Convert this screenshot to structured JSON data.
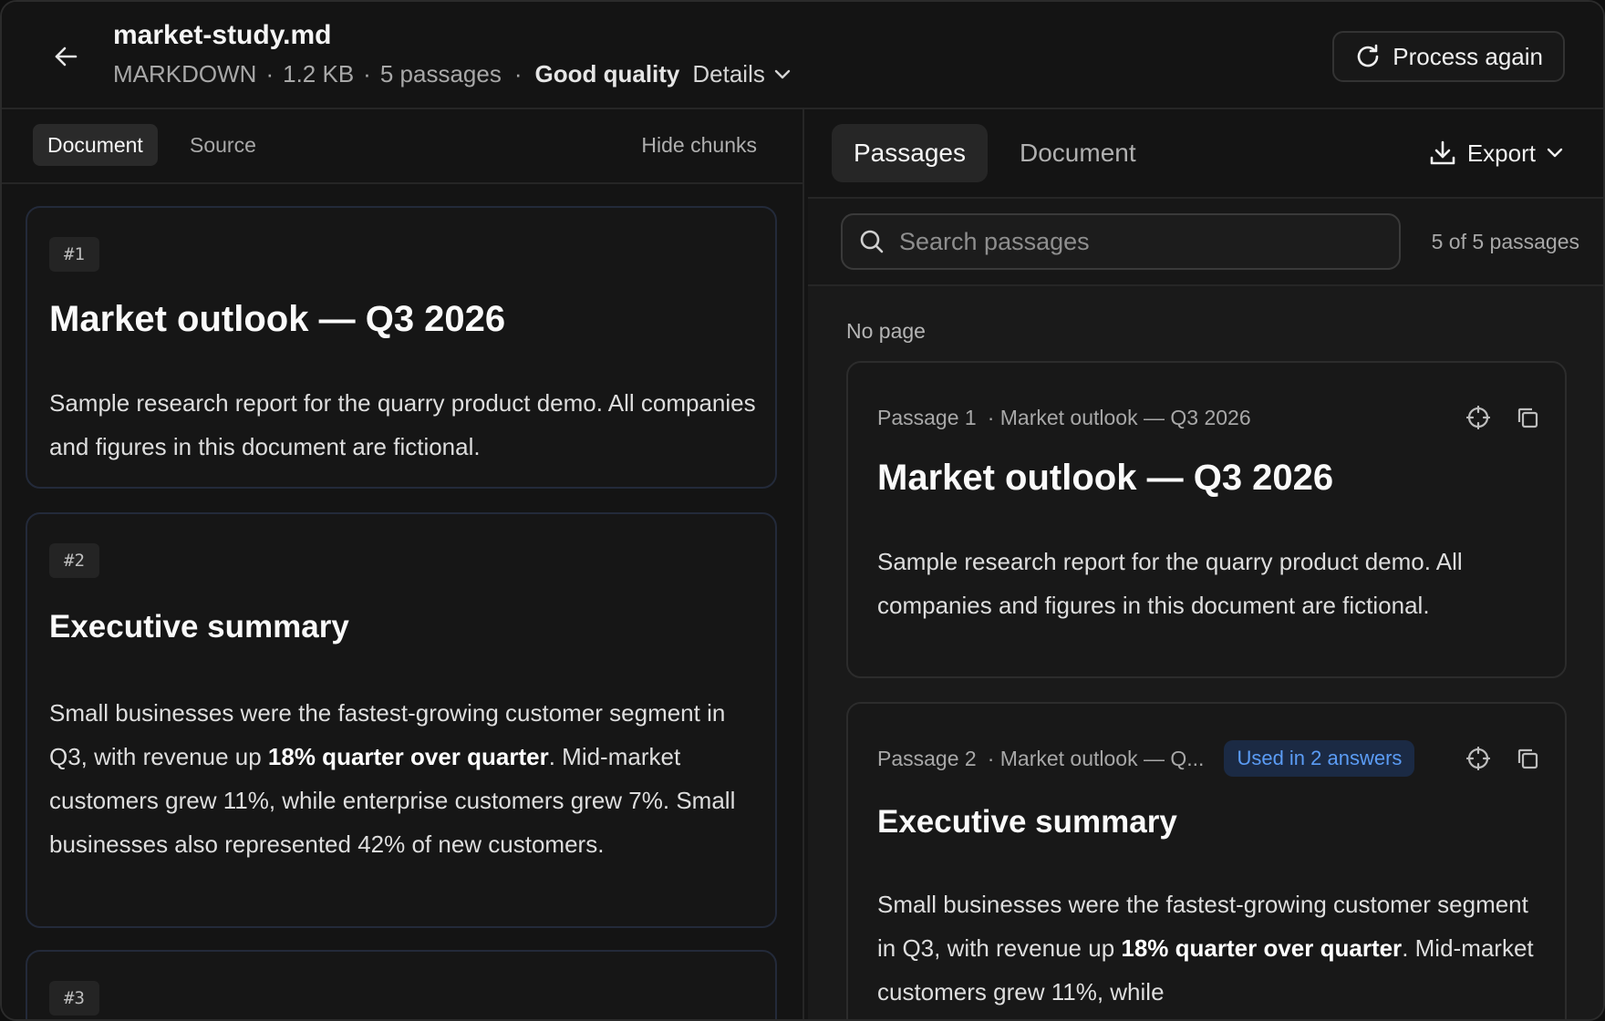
{
  "header": {
    "file_name": "market-study.md",
    "format": "MARKDOWN",
    "size": "1.2 KB",
    "passages_count": "5 passages",
    "quality": "Good quality",
    "details_label": "Details",
    "process_again_label": "Process again"
  },
  "left": {
    "tabs": {
      "document": "Document",
      "source": "Source"
    },
    "hide_chunks_label": "Hide chunks",
    "chunks": [
      {
        "badge": "#1",
        "heading": "Market outlook — Q3 2026",
        "text": "Sample research report for the quarry product demo. All companies and figures in this document are fictional."
      },
      {
        "badge": "#2",
        "heading": "Executive summary",
        "text_before": "Small businesses were the fastest-growing customer segment in Q3, with revenue up ",
        "text_bold": "18% quarter over quarter",
        "text_after": ". Mid-market customers grew 11%, while enterprise customers grew 7%. Small businesses also represented 42% of new customers."
      },
      {
        "badge": "#3"
      }
    ]
  },
  "right": {
    "tabs": {
      "passages": "Passages",
      "document": "Document"
    },
    "export_label": "Export",
    "search_placeholder": "Search passages",
    "count_label": "5 of 5 passages",
    "group_label": "No page",
    "passages": [
      {
        "label": "Passage 1",
        "heading_ref": "· Market outlook — Q3 2026",
        "heading": "Market outlook — Q3 2026",
        "text": "Sample research report for the quarry product demo. All companies and figures in this document are fictional."
      },
      {
        "label": "Passage 2",
        "heading_ref": "· Market outlook — Q...",
        "used_badge": "Used in 2 answers",
        "heading": "Executive summary",
        "text_before": "Small businesses were the fastest-growing customer segment in Q3, with revenue up ",
        "text_bold": "18% quarter over quarter",
        "text_after": ". Mid-market customers grew 11%, while"
      }
    ]
  },
  "icons": {
    "back": "arrow-left-icon",
    "refresh": "refresh-icon",
    "chevron": "chevron-down-icon",
    "download": "download-icon",
    "search": "search-icon",
    "crosshair": "crosshair-icon",
    "copy": "copy-icon"
  },
  "colors": {
    "background": "#141414",
    "accent_badge_text": "#5b9cf5",
    "accent_badge_bg": "#1b2a44"
  }
}
